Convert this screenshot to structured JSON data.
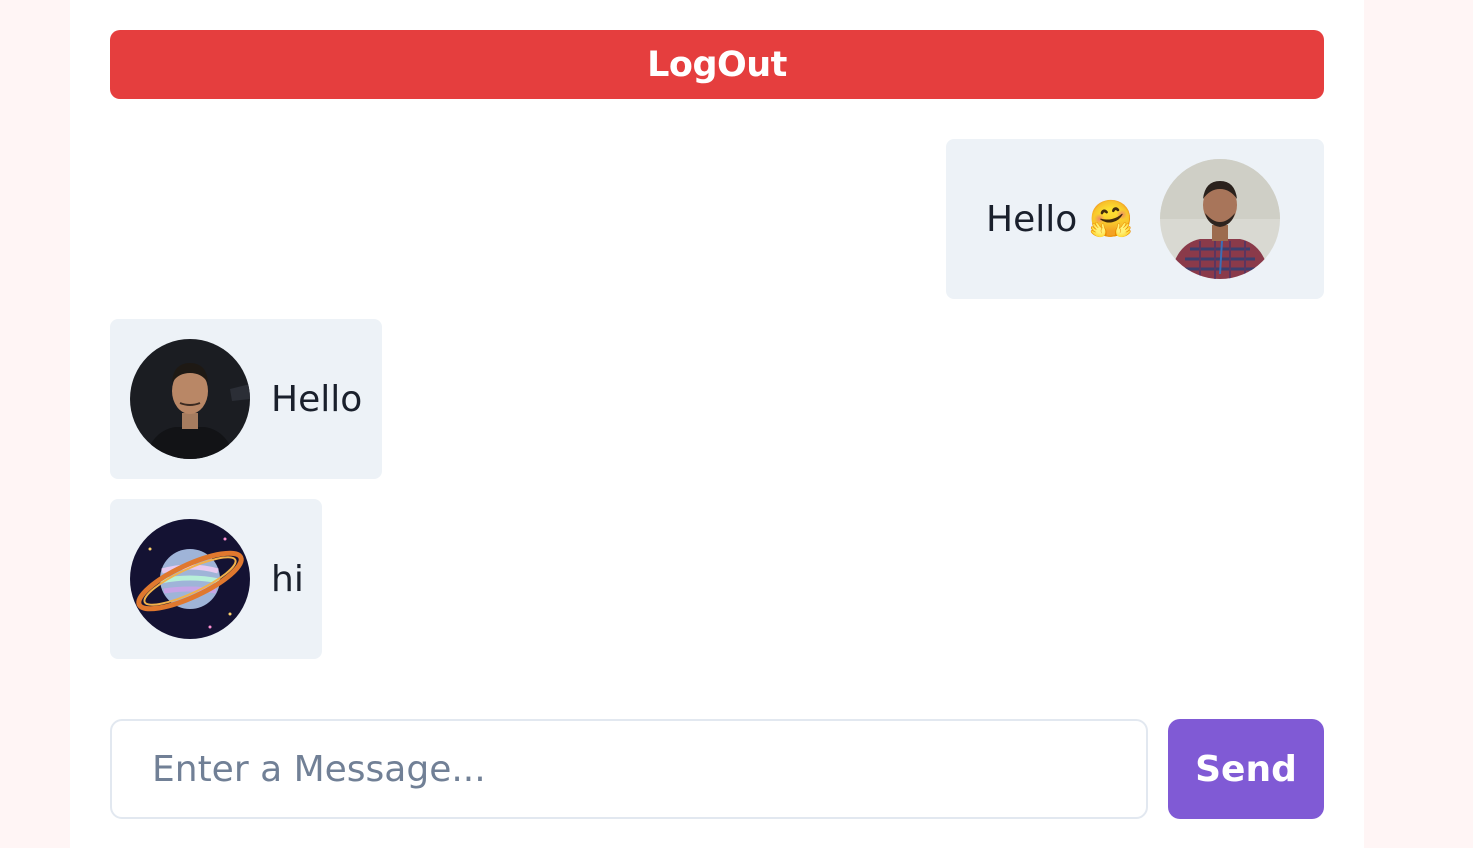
{
  "header": {
    "logout_label": "LogOut"
  },
  "messages": [
    {
      "text": "Hello 🤗",
      "side": "right",
      "avatar": "user-photo-avatar-checked-shirt"
    },
    {
      "text": "Hello",
      "side": "left",
      "avatar": "user-photo-avatar-dark"
    },
    {
      "text": "hi",
      "side": "left",
      "avatar": "saturn-planet-avatar"
    }
  ],
  "composer": {
    "placeholder": "Enter a Message...",
    "value": "",
    "send_label": "Send"
  },
  "colors": {
    "logout_button": "#e53e3e",
    "send_button": "#805ad5",
    "message_bubble": "#edf2f7",
    "page_background": "#fff5f5"
  }
}
